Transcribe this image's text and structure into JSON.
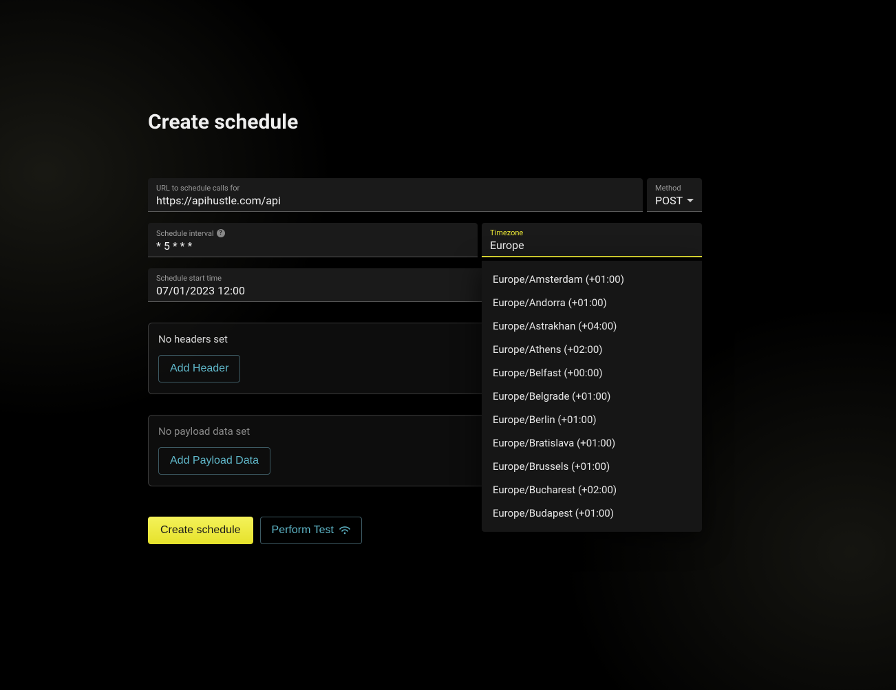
{
  "title": "Create schedule",
  "url": {
    "label": "URL to schedule calls for",
    "value": "https://apihustle.com/api"
  },
  "method": {
    "label": "Method",
    "value": "POST"
  },
  "interval": {
    "label": "Schedule interval",
    "value": "* 5 * * *"
  },
  "timezone": {
    "label": "Timezone",
    "value": "Europe",
    "options": [
      "Europe/Amsterdam (+01:00)",
      "Europe/Andorra (+01:00)",
      "Europe/Astrakhan (+04:00)",
      "Europe/Athens (+02:00)",
      "Europe/Belfast (+00:00)",
      "Europe/Belgrade (+01:00)",
      "Europe/Berlin (+01:00)",
      "Europe/Bratislava (+01:00)",
      "Europe/Brussels (+01:00)",
      "Europe/Bucharest (+02:00)",
      "Europe/Budapest (+01:00)"
    ]
  },
  "start": {
    "label": "Schedule start time",
    "value": "07/01/2023 12:00"
  },
  "headers": {
    "empty_text": "No headers set",
    "add_label": "Add Header"
  },
  "payload": {
    "empty_text": "No payload data set",
    "add_label": "Add Payload Data"
  },
  "actions": {
    "create_label": "Create schedule",
    "test_label": "Perform Test"
  }
}
